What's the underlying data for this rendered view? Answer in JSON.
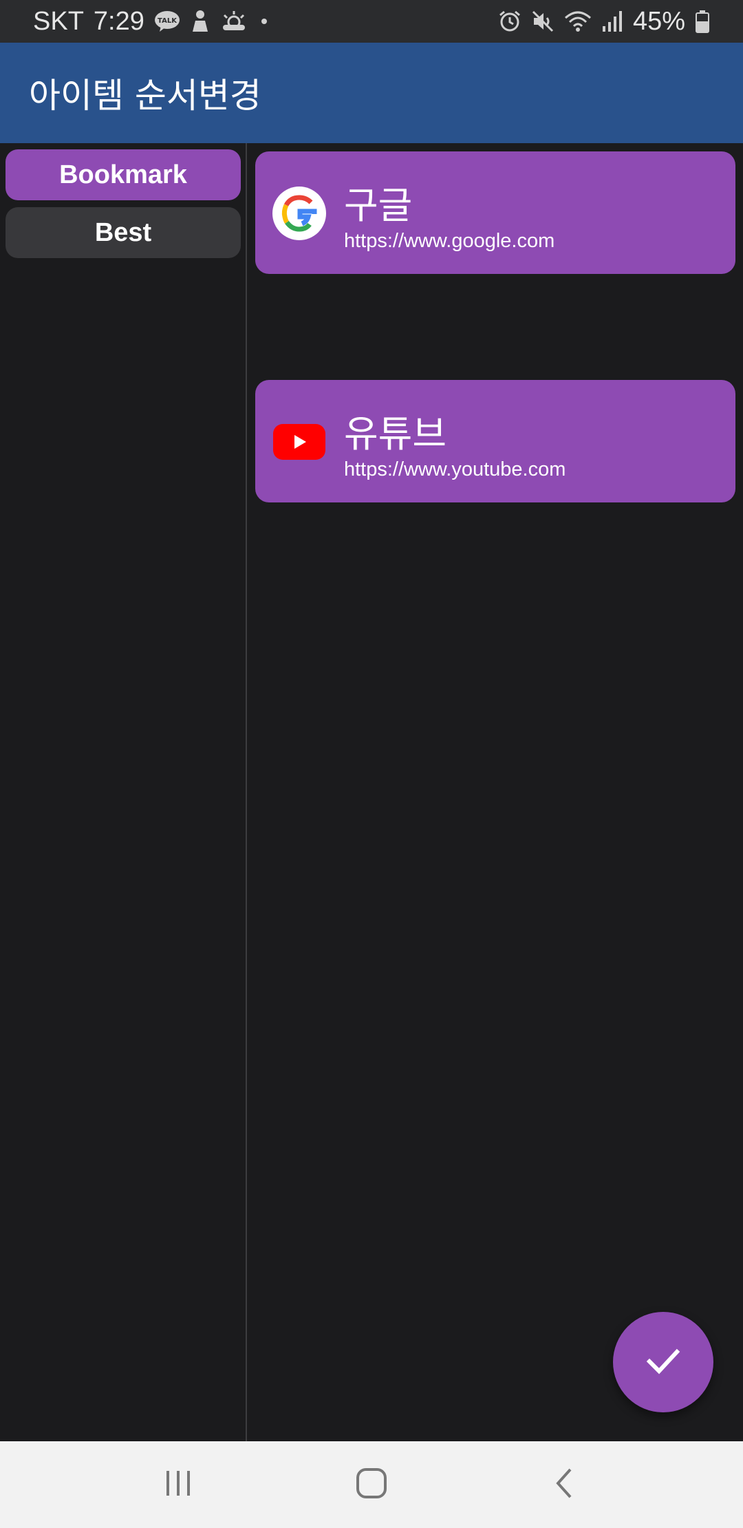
{
  "status_bar": {
    "carrier": "SKT",
    "time": "7:29",
    "left_icons": [
      "kakaotalk-icon",
      "person-icon",
      "weather-icon",
      "dot-icon"
    ],
    "right_icons": [
      "alarm-icon",
      "mute-icon",
      "wifi-icon",
      "signal-icon",
      "battery-icon"
    ],
    "battery": "45%"
  },
  "app_bar": {
    "title": "아이템 순서변경",
    "color": "#29528c"
  },
  "categories": [
    {
      "label": "Bookmark",
      "selected": true
    },
    {
      "label": "Best",
      "selected": false
    }
  ],
  "items": [
    {
      "title": "구글",
      "url": "https://www.google.com",
      "icon": "google-icon"
    },
    {
      "title": "유튜브",
      "url": "https://www.youtube.com",
      "icon": "youtube-icon"
    }
  ],
  "fab": {
    "icon": "check-icon"
  },
  "nav_bar": {
    "buttons": [
      "recent-apps-icon",
      "home-icon",
      "back-icon"
    ]
  },
  "colors": {
    "accent": "#8e4bb3",
    "background": "#1b1b1d",
    "inactive_chip": "#38383b"
  }
}
